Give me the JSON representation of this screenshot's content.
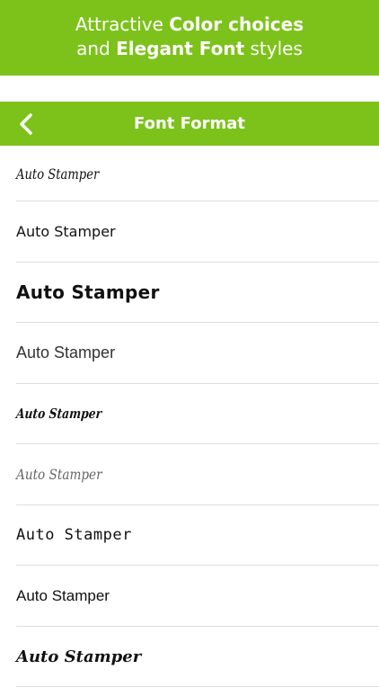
{
  "promo": {
    "line1_prefix": "Attractive ",
    "line1_bold": "Color choices",
    "line2_prefix": "and ",
    "line2_bold": "Elegant Font",
    "line2_suffix": " styles"
  },
  "nav": {
    "title": "Font Format",
    "back_icon": "chevron-left-icon"
  },
  "font_samples": [
    "Auto Stamper",
    "Auto Stamper",
    "Auto Stamper",
    "Auto Stamper",
    "Auto Stamper",
    "Auto Stamper",
    "Auto Stamper",
    "Auto Stamper",
    "Auto Stamper"
  ],
  "colors": {
    "accent": "#7cc21a",
    "text": "#111111",
    "separator": "#dedede"
  }
}
